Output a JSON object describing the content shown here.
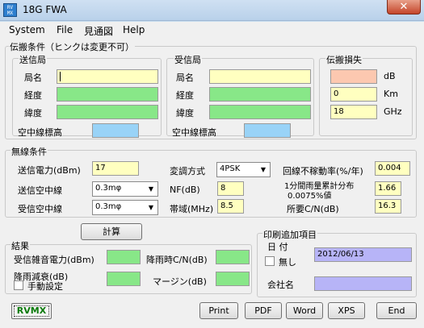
{
  "window": {
    "title": "18G FWA",
    "icon": "app-icon",
    "icon_text": "RVM\nX"
  },
  "menu": [
    "System",
    "File",
    "見通図",
    "Help"
  ],
  "propagation": {
    "title": "伝搬条件（ヒンクは変更不可）",
    "tx": {
      "title": "送信局",
      "name_label": "局名",
      "name_value": "",
      "lon_label": "経度",
      "lon_value": "",
      "lat_label": "緯度",
      "lat_value": "",
      "antenna_height_label": "空中線標高",
      "antenna_height_value": ""
    },
    "rx": {
      "title": "受信局",
      "name_label": "局名",
      "name_value": "",
      "lon_label": "経度",
      "lon_value": "",
      "lat_label": "緯度",
      "lat_value": "",
      "antenna_height_label": "空中線標高",
      "antenna_height_value": ""
    },
    "loss": {
      "title": "伝搬損失",
      "db_value": "",
      "db_unit": "dB",
      "km_value": "0",
      "km_unit": "Km",
      "ghz_value": "18",
      "ghz_unit": "GHz"
    }
  },
  "radio": {
    "title": "無線条件",
    "tx_power_label": "送信電力(dBm)",
    "tx_power_value": "17",
    "tx_antenna_label": "送信空中線",
    "tx_antenna_value": "0.3mφ",
    "rx_antenna_label": "受信空中線",
    "rx_antenna_value": "0.3mφ",
    "modulation_label": "変調方式",
    "modulation_value": "4PSK",
    "nf_label": "NF(dB)",
    "nf_value": "8",
    "bandwidth_label": "帯域(MHz)",
    "bandwidth_value": "8.5",
    "outage_label": "回線不稼動率(%/年)",
    "outage_value": "0.004",
    "rain_label_1": "1分間雨量累計分布",
    "rain_label_2": "0.0075%値",
    "rain_value": "1.66",
    "req_cn_label": "所要C/N(dB)",
    "req_cn_value": "16.3"
  },
  "calc_button": "計算",
  "result": {
    "title": "結果",
    "rx_noise_label": "受信雑音電力(dBm)",
    "rx_noise_value": "",
    "rain_cn_label": "降雨時C/N(dB)",
    "rain_cn_value": "",
    "rain_atten_label": "降雨減衰(dB)",
    "rain_atten_value": "",
    "margin_label": "マージン(dB)",
    "margin_value": "",
    "manual_label": "手動設定"
  },
  "print_extra": {
    "title": "印刷追加項目",
    "date_label": "日 付",
    "date_none_label": "無し",
    "date_value": "2012/06/13",
    "company_label": "会社名",
    "company_value": ""
  },
  "buttons": {
    "rvmx": "RVMX",
    "print": "Print",
    "pdf": "PDF",
    "word": "Word",
    "xps": "XPS",
    "end": "End"
  },
  "colors": {
    "input_yellow": "#ffffc0",
    "input_green": "#88e788",
    "input_blue": "#99d3f7",
    "input_peach": "#fcc8b0",
    "input_lavender": "#b7b4f7",
    "rvmx_green": "#0a7a0a"
  }
}
